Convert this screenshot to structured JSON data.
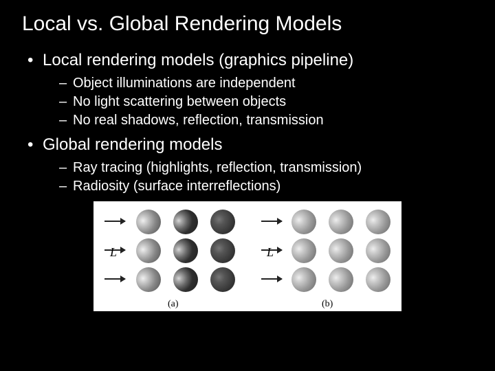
{
  "title": "Local vs. Global Rendering Models",
  "bullets": [
    {
      "label": "Local rendering models (graphics pipeline)",
      "sub": [
        "Object illuminations are independent",
        "No light scattering between objects",
        "No real shadows, reflection, transmission"
      ]
    },
    {
      "label": "Global rendering models",
      "sub": [
        "Ray tracing (highlights, reflection, transmission)",
        "Radiosity (surface interreflections)"
      ]
    }
  ],
  "figure": {
    "light_label": "L",
    "caption_a": "(a)",
    "caption_b": "(b)"
  }
}
